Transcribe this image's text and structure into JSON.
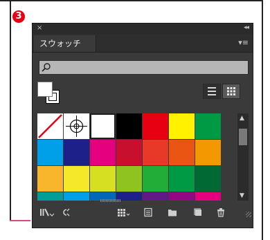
{
  "step_number": "3",
  "panel": {
    "close_glyph": "×",
    "collapse_glyph": "◂◂",
    "tab_label": "スウォッチ",
    "menu_glyph": "▾≡",
    "search": {
      "value": "",
      "placeholder": ""
    },
    "view_modes": [
      "list-view",
      "grid-view"
    ],
    "selected_view": "grid-view"
  },
  "swatches": [
    {
      "type": "none"
    },
    {
      "type": "registration"
    },
    {
      "type": "color",
      "color": "#ffffff",
      "selected": true
    },
    {
      "type": "color",
      "color": "#000000"
    },
    {
      "type": "color",
      "color": "#e60012"
    },
    {
      "type": "color",
      "color": "#fff100"
    },
    {
      "type": "color",
      "color": "#009944"
    },
    {
      "type": "color",
      "color": "#00a0e9"
    },
    {
      "type": "color",
      "color": "#1d2088"
    },
    {
      "type": "color",
      "color": "#e4007f"
    },
    {
      "type": "color",
      "color": "#c8102e"
    },
    {
      "type": "color",
      "color": "#e83828"
    },
    {
      "type": "color",
      "color": "#ea5514"
    },
    {
      "type": "color",
      "color": "#f39800"
    },
    {
      "type": "color",
      "color": "#f8b62d"
    },
    {
      "type": "color",
      "color": "#f5e82a"
    },
    {
      "type": "color",
      "color": "#d7df23"
    },
    {
      "type": "color",
      "color": "#8fc31f"
    },
    {
      "type": "color",
      "color": "#22ac38"
    },
    {
      "type": "color",
      "color": "#009944"
    },
    {
      "type": "color",
      "color": "#006934"
    },
    {
      "type": "color",
      "color": "#009e96"
    },
    {
      "type": "color",
      "color": "#00a0e9"
    },
    {
      "type": "color",
      "color": "#0068b7"
    },
    {
      "type": "color",
      "color": "#1d2088"
    },
    {
      "type": "color",
      "color": "#601986"
    },
    {
      "type": "color",
      "color": "#920783"
    },
    {
      "type": "color",
      "color": "#e4007f"
    }
  ],
  "bottom_icons": [
    "swatch-libraries-icon",
    "place-swatches-icon",
    "swatch-group-icon",
    "swatch-options-icon",
    "new-color-group-icon",
    "new-swatch-icon",
    "delete-swatch-icon"
  ]
}
